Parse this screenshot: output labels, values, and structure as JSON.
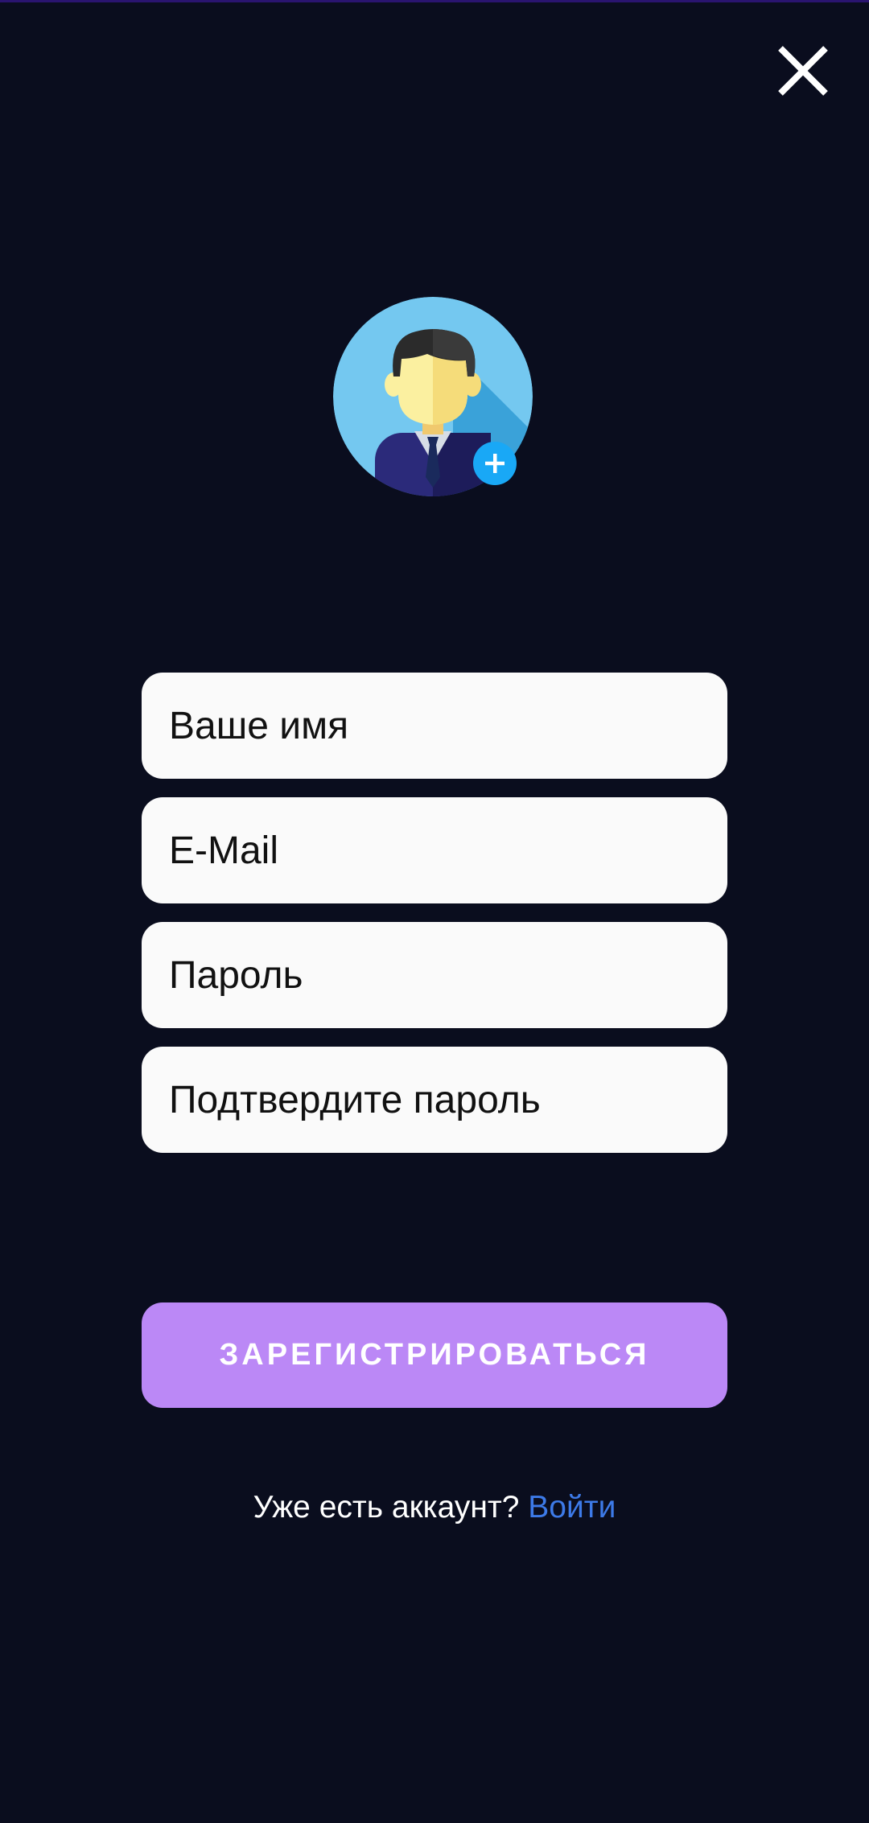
{
  "header": {
    "close_icon": "close-icon"
  },
  "avatar": {
    "icon": "user-avatar-add-icon",
    "colors": {
      "circle": "#74c8f0",
      "shadow": "#3aa2d9",
      "hair": "#2b2b2b",
      "skin": "#fbf0a0",
      "suit": "#2b2a7a",
      "tie": "#1d1c5a",
      "badge": "#19a8f6"
    }
  },
  "form": {
    "name_placeholder": "Ваше имя",
    "email_placeholder": "E-Mail",
    "password_placeholder": "Пароль",
    "confirm_password_placeholder": "Подтвердите пароль"
  },
  "actions": {
    "register_label": "ЗАРЕГИСТРИРОВАТЬСЯ"
  },
  "footer": {
    "have_account_text": "Уже есть аккаунт?",
    "login_link_label": "Войти"
  },
  "colors": {
    "background": "#0a0d1e",
    "accent": "#bb88f6",
    "link": "#3d7ae8"
  }
}
